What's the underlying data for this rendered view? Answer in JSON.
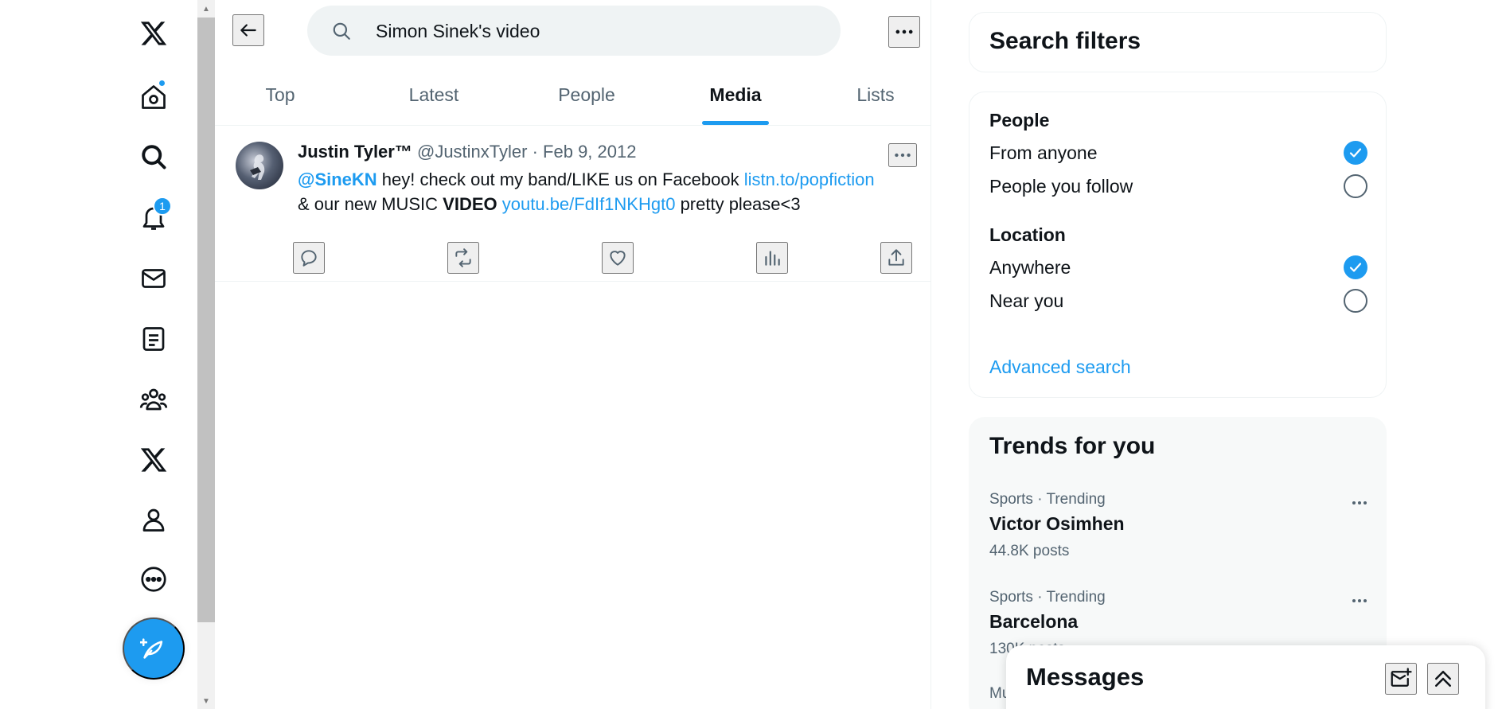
{
  "nav": {
    "items": [
      {
        "icon": "x-logo-icon"
      },
      {
        "icon": "home-icon",
        "has_dot": true
      },
      {
        "icon": "explore-icon"
      },
      {
        "icon": "notifications-icon",
        "badge": "1"
      },
      {
        "icon": "messages-icon"
      },
      {
        "icon": "lists-icon"
      },
      {
        "icon": "communities-icon"
      },
      {
        "icon": "premium-x-icon"
      },
      {
        "icon": "profile-icon"
      },
      {
        "icon": "more-icon"
      }
    ],
    "post_button_icon": "compose-feather-icon"
  },
  "search": {
    "query": "Simon Sinek's video"
  },
  "tabs": {
    "items": [
      "Top",
      "Latest",
      "People",
      "Media",
      "Lists"
    ],
    "active": "Media"
  },
  "tweet": {
    "name": "Justin Tyler™",
    "handle": "@JustinxTyler",
    "separator": "·",
    "date": "Feb 9, 2012",
    "mention": "@SineKN",
    "text1": " hey! check out my band/LIKE us on Facebook ",
    "link1": "listn.to/popfiction",
    "text2": "& our new MUSIC ",
    "bold": "VIDEO",
    "text3": " ",
    "link2": "youtu.be/FdIf1NKHgt0",
    "text4": " pretty please<3"
  },
  "filters": {
    "title": "Search filters",
    "people_heading": "People",
    "people_options": [
      {
        "label": "From anyone",
        "checked": true
      },
      {
        "label": "People you follow",
        "checked": false
      }
    ],
    "location_heading": "Location",
    "location_options": [
      {
        "label": "Anywhere",
        "checked": true
      },
      {
        "label": "Near you",
        "checked": false
      }
    ],
    "advanced": "Advanced search"
  },
  "trends": {
    "title": "Trends for you",
    "items": [
      {
        "context": "Sports · Trending",
        "name": "Victor Osimhen",
        "count": "44.8K posts"
      },
      {
        "context": "Sports · Trending",
        "name": "Barcelona",
        "count": "130K posts"
      },
      {
        "context": "Mu",
        "name": "",
        "count": ""
      }
    ]
  },
  "messages": {
    "title": "Messages"
  },
  "colors": {
    "accent": "#1d9bf0",
    "text": "#0f1419",
    "secondary": "#536471"
  }
}
